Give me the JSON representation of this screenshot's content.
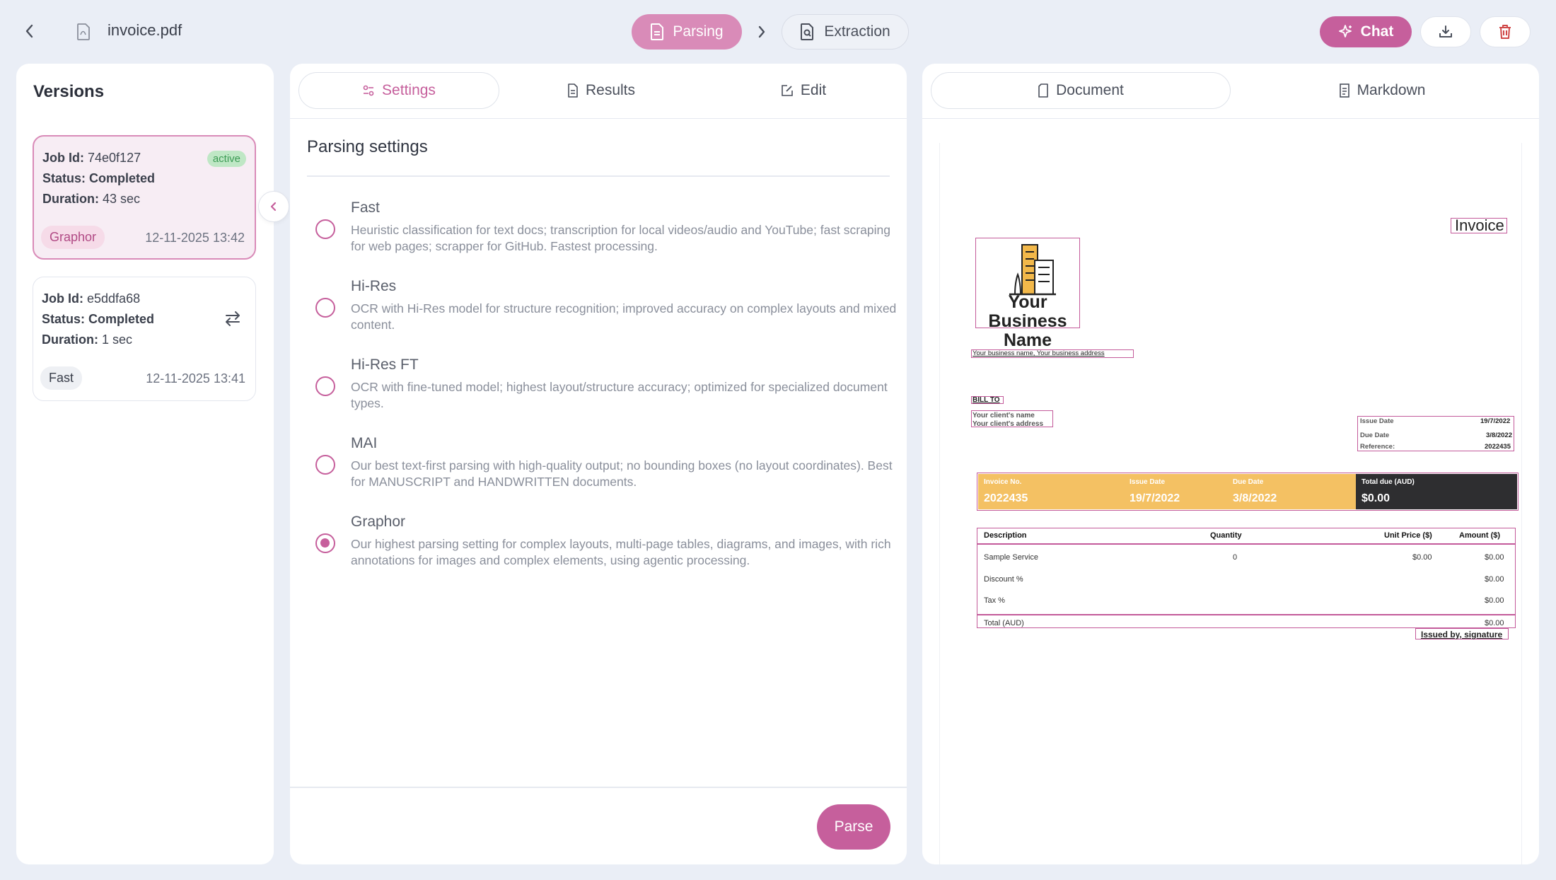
{
  "topbar": {
    "file_name": "invoice.pdf",
    "steps": {
      "parsing": "Parsing",
      "extraction": "Extraction"
    },
    "chat_label": "Chat"
  },
  "versions": {
    "title": "Versions",
    "items": [
      {
        "job_id_label": "Job Id:",
        "job_id": "74e0f127",
        "status_label": "Status:",
        "status": "Completed",
        "duration_label": "Duration:",
        "duration": "43 sec",
        "badge": "active",
        "method": "Graphor",
        "date": "12-11-2025 13:42"
      },
      {
        "job_id_label": "Job Id:",
        "job_id": "e5ddfa68",
        "status_label": "Status:",
        "status": "Completed",
        "duration_label": "Duration:",
        "duration": "1 sec",
        "method": "Fast",
        "date": "12-11-2025 13:41"
      }
    ]
  },
  "settings": {
    "tabs": [
      "Settings",
      "Results",
      "Edit"
    ],
    "title": "Parsing settings",
    "options": [
      {
        "name": "Fast",
        "description": "Heuristic classification for text docs; transcription for local videos/audio and YouTube; fast scraping for web pages; scrapper for GitHub. Fastest processing.",
        "selected": false
      },
      {
        "name": "Hi-Res",
        "description": "OCR with Hi-Res model for structure recognition; improved accuracy on complex layouts and mixed content.",
        "selected": false
      },
      {
        "name": "Hi-Res FT",
        "description": "OCR with fine-tuned model; highest layout/structure accuracy; optimized for specialized document types.",
        "selected": false
      },
      {
        "name": "MAI",
        "description": "Our best text-first parsing with high-quality output; no bounding boxes (no layout coordinates). Best for MANUSCRIPT and HANDWRITTEN documents.",
        "selected": false
      },
      {
        "name": "Graphor",
        "description": "Our highest parsing setting for complex layouts, multi-page tables, diagrams, and images, with rich annotations for images and complex elements, using agentic processing.",
        "selected": true
      }
    ],
    "parse_label": "Parse"
  },
  "document": {
    "tabs": [
      "Document",
      "Markdown"
    ],
    "invoice": {
      "heading": "Invoice",
      "business_logo_line1": "Your Business",
      "business_logo_line2": "Name",
      "business_address": "Your business name, Your business address",
      "bill_to": "BILL TO",
      "client_name": "Your client's name",
      "client_address": "Your client's address",
      "meta": [
        {
          "label": "Issue Date",
          "value": "19/7/2022"
        },
        {
          "label": "Due Date",
          "value": "3/8/2022"
        },
        {
          "label": "Reference:",
          "value": "2022435"
        }
      ],
      "band": {
        "invoice_no_label": "Invoice No.",
        "invoice_no": "2022435",
        "issue_date_label": "Issue Date",
        "issue_date": "19/7/2022",
        "due_date_label": "Due Date",
        "due_date": "3/8/2022",
        "total_due_label": "Total due (AUD)",
        "total_due": "$0.00"
      },
      "table": {
        "headers": [
          "Description",
          "Quantity",
          "Unit Price ($)",
          "Amount ($)"
        ],
        "rows": [
          [
            "Sample Service",
            "0",
            "$0.00",
            "$0.00"
          ],
          [
            "Discount %",
            "",
            "",
            "$0.00"
          ],
          [
            "Tax %",
            "",
            "",
            "$0.00"
          ],
          [
            "Total (AUD)",
            "",
            "",
            "$0.00"
          ]
        ]
      },
      "signature": "Issued by, signature"
    }
  },
  "colors": {
    "accent": "#c65f9c",
    "accent_light": "#d98bb8",
    "invoice_band": "#f4c163",
    "invoice_dark": "#2e2e30"
  }
}
